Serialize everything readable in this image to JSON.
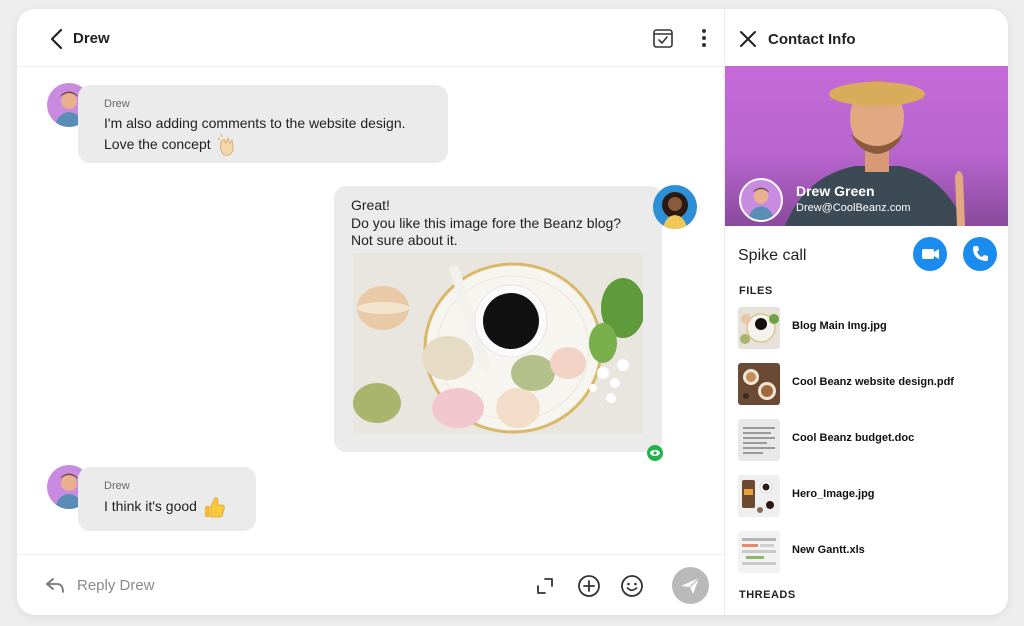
{
  "chat": {
    "title": "Drew",
    "messages": [
      {
        "sender": "Drew",
        "lines": [
          "I'm also adding comments to the website design.",
          "Love the concept"
        ]
      },
      {
        "lines": [
          "Great!",
          "Do you like this image fore the Beanz blog?",
          "Not sure about it."
        ]
      },
      {
        "sender": "Drew",
        "lines": [
          "I think it's good"
        ]
      }
    ]
  },
  "composer": {
    "placeholder": "Reply Drew"
  },
  "contact": {
    "title": "Contact Info",
    "name": "Drew Green",
    "email": "Drew@CoolBeanz.com",
    "call_label": "Spike call",
    "files_label": "FILES",
    "files": [
      {
        "name": "Blog Main Img.jpg",
        "thumb": "coffee-macaron-thumb"
      },
      {
        "name": "Cool Beanz website design.pdf",
        "thumb": "coffee-cups-thumb"
      },
      {
        "name": "Cool Beanz budget.doc",
        "thumb": "doc-lines-thumb"
      },
      {
        "name": "Hero_Image.jpg",
        "thumb": "coffee-bag-thumb"
      },
      {
        "name": "New Gantt.xls",
        "thumb": "spreadsheet-thumb"
      }
    ],
    "threads_label": "THREADS"
  },
  "colors": {
    "accent_blue": "#1a8cf0",
    "bubble_gray": "#ebebeb",
    "hero_purple": "#c46ad8",
    "seen_green": "#22b14c"
  }
}
